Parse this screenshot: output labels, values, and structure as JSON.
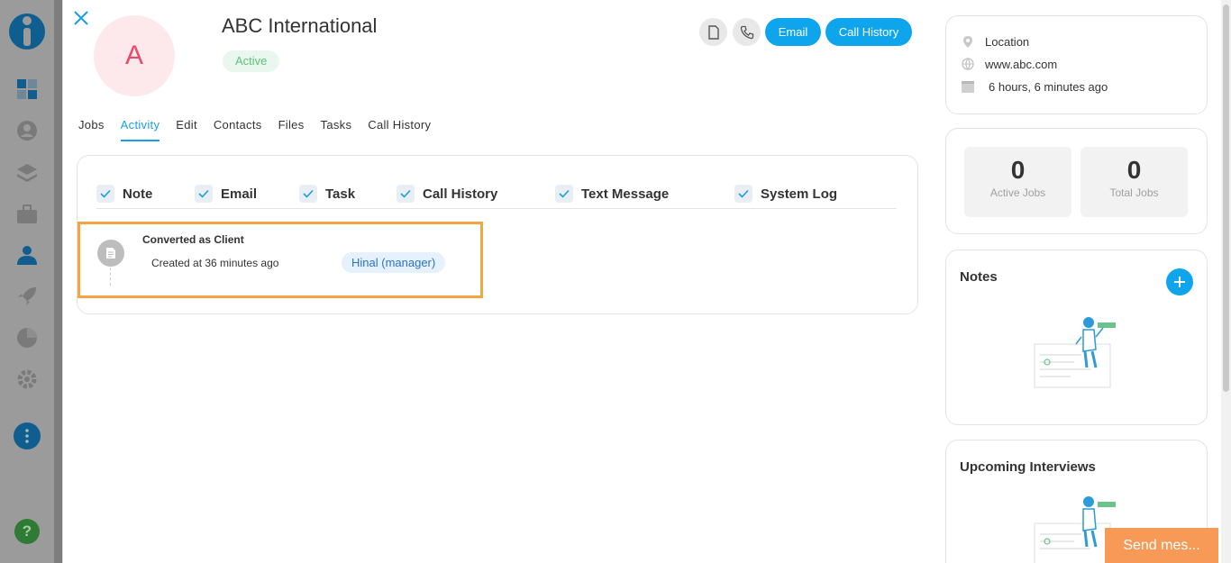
{
  "header": {
    "avatar_letter": "A",
    "company_name": "ABC International",
    "status": "Active",
    "email_label": "Email",
    "call_history_label": "Call History"
  },
  "tabs": [
    {
      "label": "Jobs"
    },
    {
      "label": "Activity",
      "active": true
    },
    {
      "label": "Edit"
    },
    {
      "label": "Contacts"
    },
    {
      "label": "Files"
    },
    {
      "label": "Tasks"
    },
    {
      "label": "Call History"
    }
  ],
  "filters": [
    {
      "label": "Note",
      "checked": true
    },
    {
      "label": "Email",
      "checked": true
    },
    {
      "label": "Task",
      "checked": true
    },
    {
      "label": "Call History",
      "checked": true
    },
    {
      "label": "Text Message",
      "checked": true
    },
    {
      "label": "System Log",
      "checked": true
    }
  ],
  "activity": [
    {
      "title": "Converted as Client",
      "time": "Created at 36 minutes ago",
      "user": "Hinal (manager)"
    }
  ],
  "info": {
    "location": "Location",
    "website": "www.abc.com",
    "updated": "6 hours, 6 minutes ago"
  },
  "stats": {
    "active_jobs_value": "0",
    "active_jobs_label": "Active Jobs",
    "total_jobs_value": "0",
    "total_jobs_label": "Total Jobs"
  },
  "notes": {
    "title": "Notes"
  },
  "interviews": {
    "title": "Upcoming Interviews"
  },
  "chat": {
    "label": "Send mes..."
  },
  "colors": {
    "accent": "#0ea5ec",
    "active_badge_text": "#5cc27a",
    "highlight_border": "#f4a440",
    "avatar_text": "#e84a6a",
    "chat_button": "#f79a57"
  }
}
